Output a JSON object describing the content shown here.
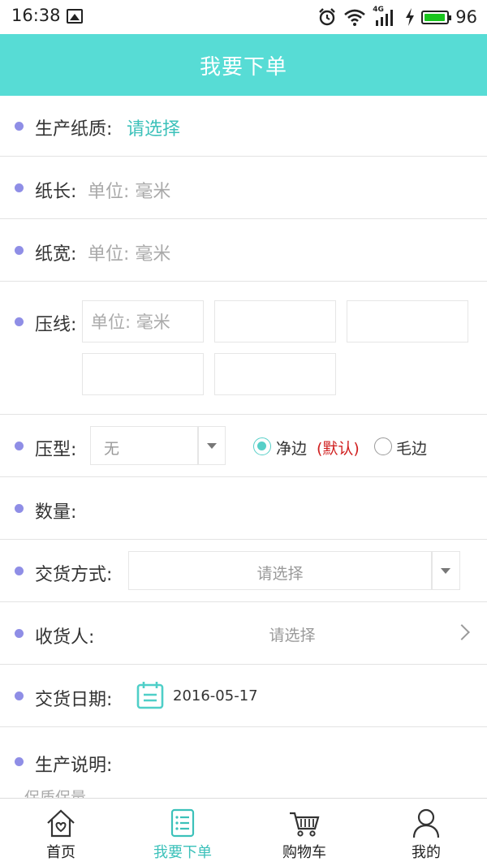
{
  "status_bar": {
    "time": "16:38",
    "network": "4G",
    "battery_percent": "96",
    "battery_level": 0.96,
    "icons": [
      "image-icon",
      "alarm-icon",
      "wifi-icon",
      "signal-icon",
      "charging-icon",
      "battery-icon"
    ]
  },
  "header": {
    "title": "我要下单"
  },
  "form": {
    "paper_quality": {
      "label": "生产纸质:",
      "value": "请选择"
    },
    "paper_length": {
      "label": "纸长:",
      "placeholder": "单位: 毫米"
    },
    "paper_width": {
      "label": "纸宽:",
      "placeholder": "单位: 毫米"
    },
    "crease": {
      "label": "压线:",
      "inputs": [
        {
          "placeholder": "单位: 毫米"
        },
        {
          "placeholder": ""
        },
        {
          "placeholder": ""
        },
        {
          "placeholder": ""
        },
        {
          "placeholder": ""
        }
      ]
    },
    "press_type": {
      "label": "压型:",
      "select_value": "无",
      "options": [
        {
          "label": "净边",
          "note": "(默认)",
          "selected": true
        },
        {
          "label": "毛边",
          "selected": false
        }
      ]
    },
    "quantity": {
      "label": "数量:"
    },
    "delivery_method": {
      "label": "交货方式:",
      "select_value": "请选择"
    },
    "receiver": {
      "label": "收货人:",
      "value": "请选择"
    },
    "delivery_date": {
      "label": "交货日期:",
      "value": "2016-05-17"
    },
    "production_note": {
      "label": "生产说明:",
      "partial_text": "保质保量"
    }
  },
  "bottom_nav": {
    "items": [
      {
        "label": "首页",
        "icon": "home-icon",
        "active": false
      },
      {
        "label": "我要下单",
        "icon": "order-list-icon",
        "active": true
      },
      {
        "label": "购物车",
        "icon": "cart-icon",
        "active": false
      },
      {
        "label": "我的",
        "icon": "user-icon",
        "active": false
      }
    ]
  },
  "colors": {
    "accent": "#57dcd5",
    "accent_text": "#3cc1ba",
    "bullet": "#8f8ee6",
    "default_note": "#d02020",
    "battery": "#19c51e"
  }
}
